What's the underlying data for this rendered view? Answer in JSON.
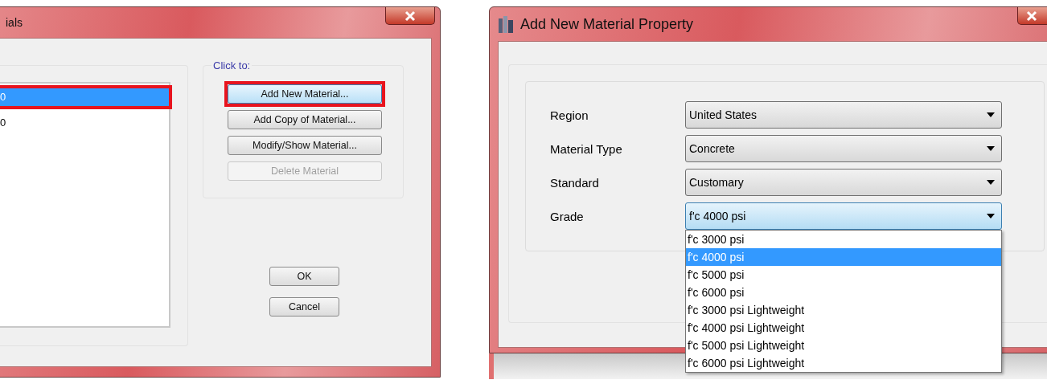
{
  "materials_window": {
    "title": "ials",
    "list": [
      {
        "label": "0",
        "selected": true,
        "annotated": true
      },
      {
        "label": "0",
        "selected": false,
        "annotated": false
      }
    ],
    "group_label": "Click to:",
    "buttons": [
      {
        "label": "Add New Material...",
        "disabled": false,
        "annotated": true,
        "hovered": true
      },
      {
        "label": "Add Copy of Material...",
        "disabled": false,
        "annotated": false,
        "hovered": false
      },
      {
        "label": "Modify/Show Material...",
        "disabled": false,
        "annotated": false,
        "hovered": false
      },
      {
        "label": "Delete Material",
        "disabled": true,
        "annotated": false,
        "hovered": false
      }
    ],
    "dialog_buttons": [
      "OK",
      "Cancel"
    ]
  },
  "property_window": {
    "title": "Add New Material Property",
    "fields": [
      {
        "label": "Region",
        "value": "United States",
        "focused": false
      },
      {
        "label": "Material Type",
        "value": "Concrete",
        "focused": false
      },
      {
        "label": "Standard",
        "value": "Customary",
        "focused": false
      },
      {
        "label": "Grade",
        "value": "f'c 4000 psi",
        "focused": true
      }
    ],
    "dropdown": [
      {
        "label": "f'c 3000 psi",
        "selected": false
      },
      {
        "label": "f'c 4000 psi",
        "selected": true
      },
      {
        "label": "f'c 5000 psi",
        "selected": false
      },
      {
        "label": "f'c 6000 psi",
        "selected": false
      },
      {
        "label": "f'c 3000 psi Lightweight",
        "selected": false
      },
      {
        "label": "f'c 4000 psi Lightweight",
        "selected": false
      },
      {
        "label": "f'c 5000 psi Lightweight",
        "selected": false
      },
      {
        "label": "f'c 6000 psi Lightweight",
        "selected": false
      }
    ]
  }
}
